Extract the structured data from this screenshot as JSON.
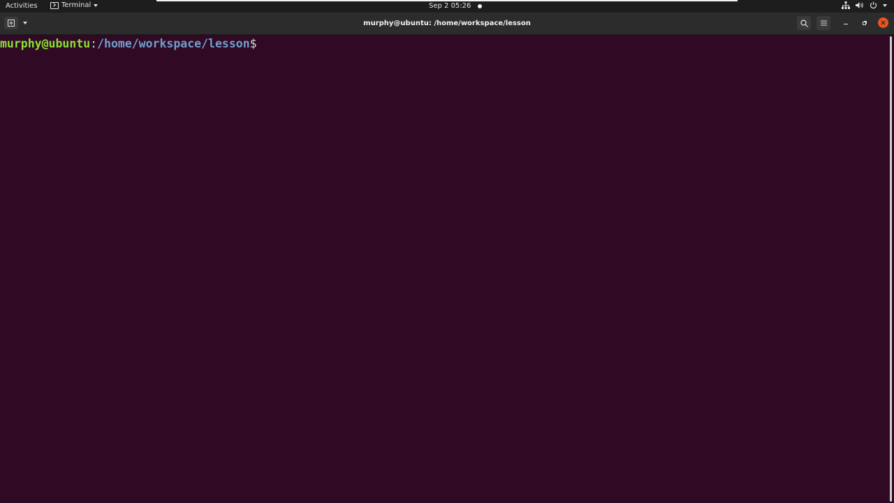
{
  "topbar": {
    "activities": "Activities",
    "app_menu_label": "Terminal",
    "clock": "Sep 2  05:26",
    "tray_icons": [
      "network-icon",
      "volume-icon",
      "power-icon",
      "chevron-down-icon"
    ]
  },
  "window": {
    "title": "murphy@ubuntu: /home/workspace/lesson",
    "header_icons": [
      "new-tab-icon",
      "chevron-down-icon",
      "search-icon",
      "hamburger-menu-icon",
      "minimize-icon",
      "restore-icon",
      "close-icon"
    ]
  },
  "terminal": {
    "prompt_user": "murphy@ubuntu",
    "prompt_colon": ":",
    "prompt_path": "/home/workspace/lesson",
    "prompt_symbol": "$",
    "input": ""
  },
  "colors": {
    "terminal_bg": "#300a24",
    "user_green": "#8ae234",
    "path_blue": "#729fcf",
    "close_orange": "#e95420"
  }
}
